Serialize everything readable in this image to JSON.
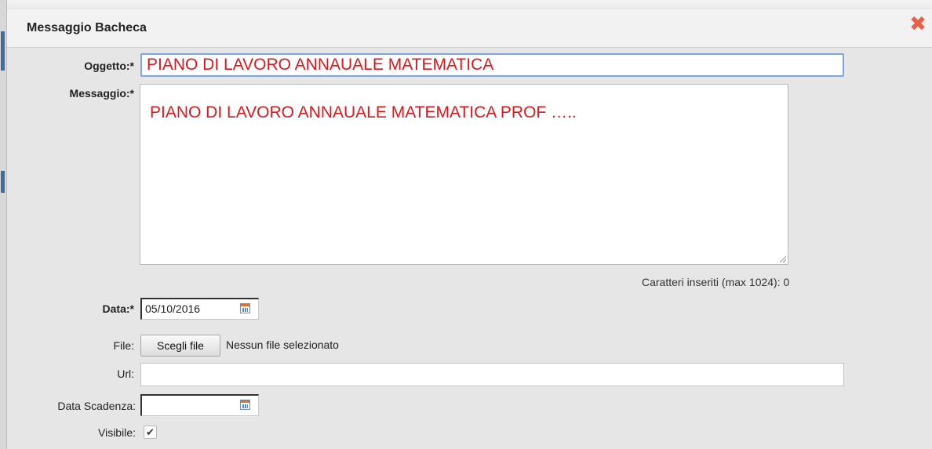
{
  "dialog": {
    "title": "Messaggio Bacheca",
    "close_icon": "close-icon",
    "close_glyph": "✖"
  },
  "form": {
    "oggetto": {
      "label": "Oggetto:*",
      "value": "PIANO DI LAVORO ANNAUALE MATEMATICA"
    },
    "messaggio": {
      "label": "Messaggio:*",
      "value": "PIANO DI LAVORO ANNAUALE MATEMATICA PROF …..",
      "counter": "Caratteri inseriti (max 1024): 0"
    },
    "data": {
      "label": "Data:*",
      "value": "05/10/2016",
      "icon": "calendar-icon"
    },
    "file": {
      "label": "File:",
      "button_label": "Scegli file",
      "status": "Nessun file selezionato"
    },
    "url": {
      "label": "Url:",
      "value": ""
    },
    "data_scadenza": {
      "label": "Data Scadenza:",
      "value": "",
      "icon": "calendar-icon"
    },
    "visibile": {
      "label": "Visibile:",
      "checked": true,
      "check_glyph": "✔"
    }
  },
  "colors": {
    "accent_text": "#e0161b",
    "close": "#e8604a",
    "focus_border": "#7ea6d8"
  }
}
